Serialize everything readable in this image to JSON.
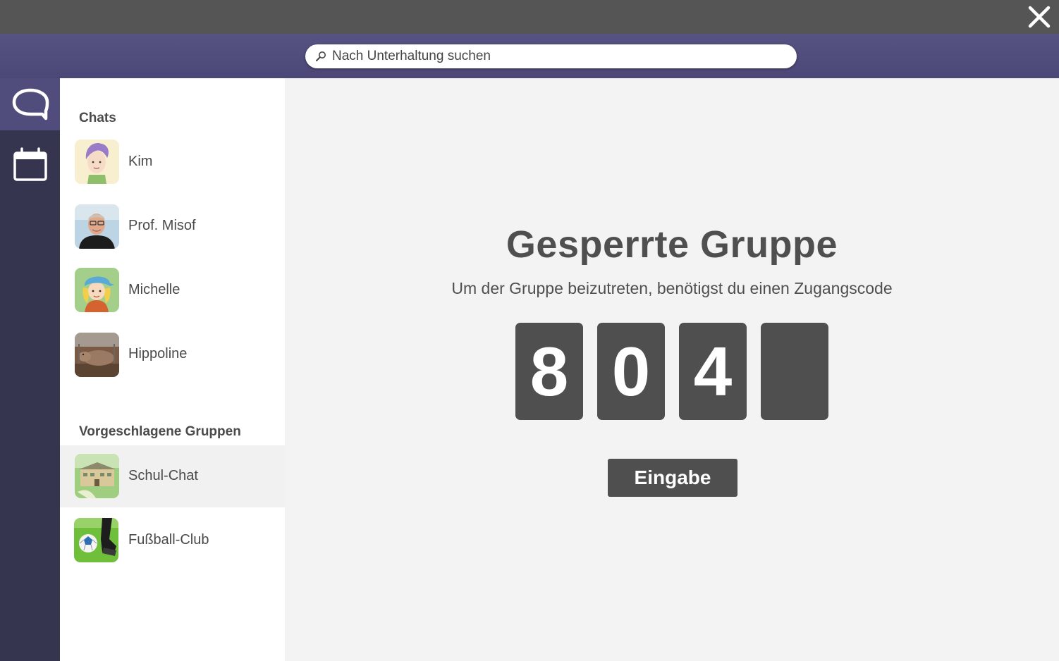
{
  "search": {
    "placeholder": "Nach Unterhaltung suchen",
    "icon": "search-icon"
  },
  "rail": {
    "items": [
      {
        "icon": "chat-bubble-icon",
        "active": true
      },
      {
        "icon": "calendar-icon",
        "active": false
      }
    ]
  },
  "sidebar": {
    "chats_title": "Chats",
    "chats": [
      {
        "name": "Kim"
      },
      {
        "name": "Prof. Misof"
      },
      {
        "name": "Michelle"
      },
      {
        "name": "Hippoline"
      }
    ],
    "groups_title": "Vorgeschlagene Gruppen",
    "groups": [
      {
        "name": "Schul-Chat",
        "selected": true
      },
      {
        "name": "Fußball-Club",
        "selected": false
      }
    ]
  },
  "main": {
    "title": "Gesperrte Gruppe",
    "subtitle": "Um der Gruppe beizutreten, benötigst du einen Zugangscode",
    "code_digits": [
      "8",
      "0",
      "4",
      ""
    ],
    "submit_label": "Eingabe"
  },
  "colors": {
    "titlebar": "#555555",
    "header_purple": "#524e7e",
    "rail": "#36354f",
    "rail_active": "#504d7c",
    "digit_box": "#4f4f4f"
  }
}
